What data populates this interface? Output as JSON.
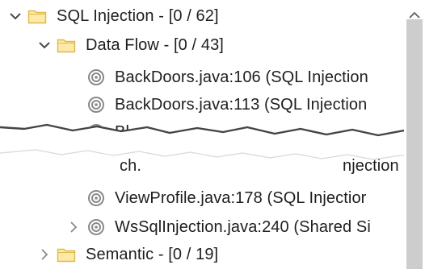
{
  "tree": {
    "root": {
      "label": "SQL Injection - [0 / 62]",
      "expanded": true
    },
    "group": {
      "label": "Data Flow - [0 / 43]",
      "expanded": true
    },
    "items_top": [
      {
        "label": "BackDoors.java:106 (SQL Injection"
      },
      {
        "label": "BackDoors.java:113 (SQL Injection"
      }
    ],
    "fragment_top": "Bl",
    "fragment_bottom_left": "ch.",
    "fragment_bottom_right": "njection",
    "items_bottom": [
      {
        "label": "ViewProfile.java:178 (SQL Injectior",
        "expandable": false
      },
      {
        "label": "WsSqlInjection.java:240 (Shared Si",
        "expandable": true
      }
    ],
    "sibling_group": {
      "label": "Semantic - [0 / 19]",
      "expanded": false
    }
  },
  "colors": {
    "folder_fill": "#fde9a8",
    "folder_stroke": "#e0b84a",
    "chevron": "#5a5a5a",
    "issue_icon": "#8a8a8a",
    "scroll_thumb": "#cdcdcd"
  },
  "icons": {
    "expanded": "chevron-down-icon",
    "collapsed": "chevron-right-icon",
    "folder": "folder-icon",
    "issue": "issue-target-icon",
    "scroll_up": "scroll-up-arrow-icon"
  }
}
